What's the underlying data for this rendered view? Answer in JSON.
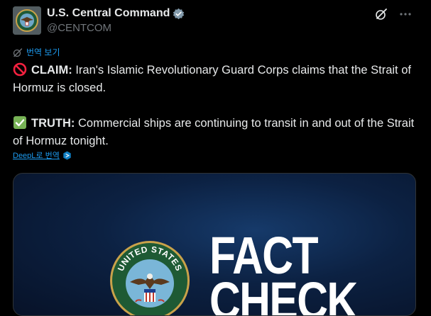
{
  "author": {
    "display_name": "U.S. Central Command",
    "handle": "@CENTCOM"
  },
  "translate_label": "번역 보기",
  "tweet": {
    "claim_lead": "CLAIM:",
    "claim_body": " Iran's Islamic Revolutionary Guard Corps claims that the Strait of Hormuz is closed.",
    "truth_lead": "TRUTH:",
    "truth_body": " Commercial ships are continuing to transit in and out of the Strait of Hormuz tonight."
  },
  "deepl_label": "DeepL로 번역",
  "media": {
    "seal_text_top": "UNITED STATES",
    "headline_line1": "FACT",
    "headline_line2": "CHECK"
  },
  "colors": {
    "accent": "#1d9bf0",
    "background": "#000000",
    "text": "#e7e9ea",
    "secondary": "#71767b"
  },
  "icons": [
    "verified-badge-icon",
    "grok-icon",
    "more-icon",
    "translate-icon",
    "prohibited-emoji-icon",
    "check-emoji-icon",
    "deepl-icon"
  ]
}
